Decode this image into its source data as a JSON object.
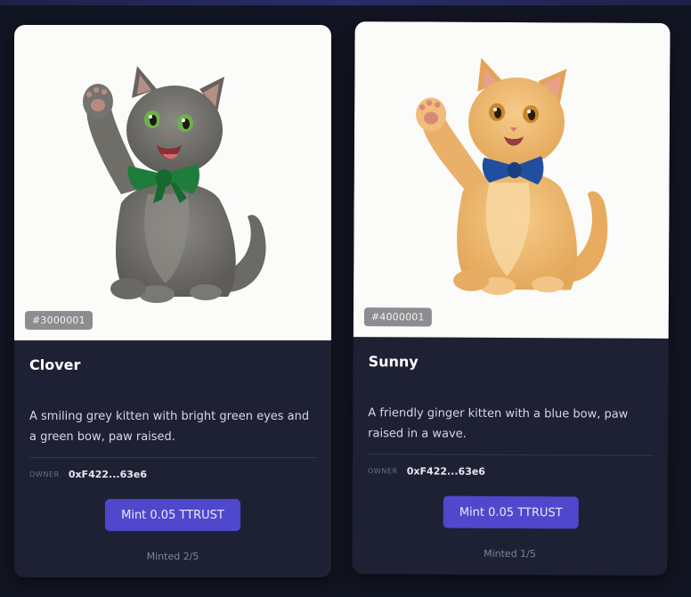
{
  "cards": [
    {
      "token_id": "#3000001",
      "title": "Clover",
      "description": "A smiling grey kitten with bright green eyes and a green bow, paw raised.",
      "owner_label": "OWNER",
      "owner_value": "0xF422...63e6",
      "mint_label": "Mint 0.05 TTRUST",
      "minted_text": "Minted 2/5",
      "image_icon": "grey-kitten-image",
      "colors": {
        "fur": "#76746f",
        "bow": "#1e7d3a",
        "eyes": "#6fb04a"
      }
    },
    {
      "token_id": "#4000001",
      "title": "Sunny",
      "description": "A friendly ginger kitten with a blue bow, paw raised in a wave.",
      "owner_label": "OWNER",
      "owner_value": "0xF422...63e6",
      "mint_label": "Mint 0.05 TTRUST",
      "minted_text": "Minted 1/5",
      "image_icon": "ginger-kitten-image",
      "colors": {
        "fur": "#eeb76c",
        "bow": "#1f4f9e",
        "eyes": "#c8872a"
      }
    }
  ],
  "theme": {
    "background": "#121522",
    "card": "#1e2133",
    "accent": "#4f47cc"
  }
}
